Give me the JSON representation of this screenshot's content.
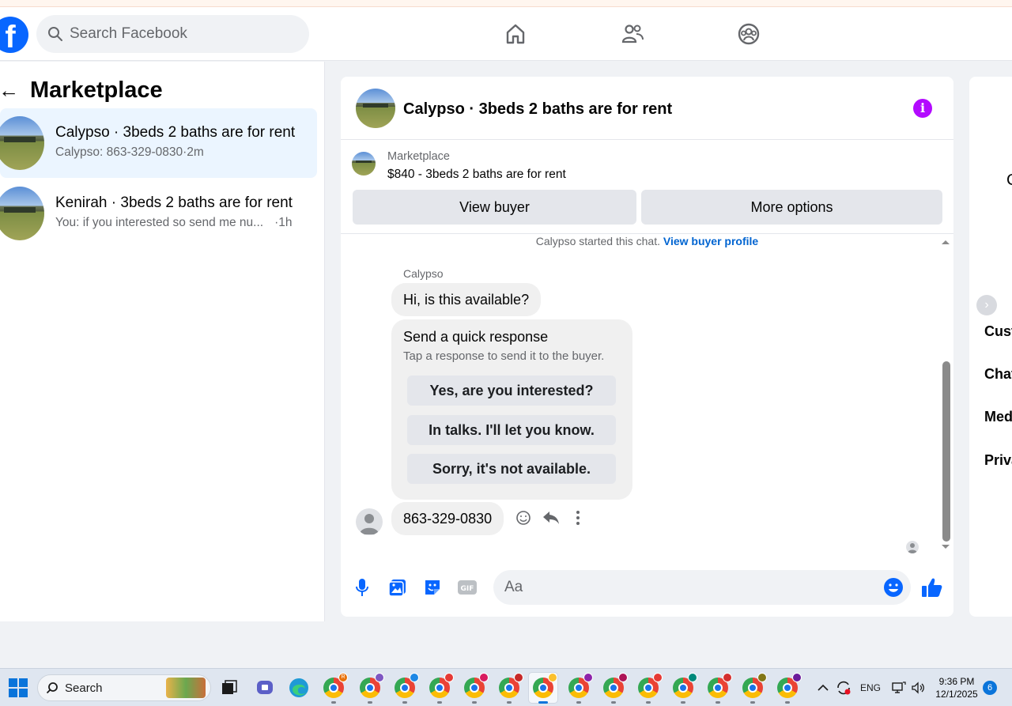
{
  "header": {
    "logo": "f",
    "search_placeholder": "Search Facebook",
    "nav": [
      "home-icon",
      "friends-icon",
      "groups-icon"
    ]
  },
  "left": {
    "title": "Marketplace",
    "conversations": [
      {
        "name": "Calypso · 3beds 2 baths are for rent",
        "preview": "Calypso: 863-329-0830·2m"
      },
      {
        "name": "Kenirah · 3beds 2 baths are for rent",
        "preview": "You: if you interested so send me nu...",
        "time": "·1h"
      }
    ]
  },
  "chat": {
    "title": "Calypso · 3beds 2 baths are for rent",
    "listing": {
      "category": "Marketplace",
      "price_title": "$840 - 3beds 2 baths are for rent",
      "view_buyer": "View buyer",
      "more_options": "More options"
    },
    "started_text": "Calypso started this chat.",
    "buyer_profile_link": "View buyer profile",
    "sender": "Calypso",
    "message1": "Hi, is this available?",
    "quick_response": {
      "title": "Send a quick response",
      "subtitle": "Tap a response to send it to the buyer.",
      "options": [
        "Yes, are you interested?",
        "In talks. I'll let you know.",
        "Sorry, it's not available."
      ]
    },
    "message2": "863-329-0830",
    "composer_placeholder": "Aa"
  },
  "right": {
    "letter": "C",
    "items": [
      "Cust",
      "Chat",
      "Med",
      "Priva"
    ]
  },
  "taskbar": {
    "search_label": "Search",
    "lang": "ENG",
    "time": "9:36 PM",
    "date": "12/1/2025",
    "notifications": "6",
    "profile_badge": "R"
  },
  "colors": {
    "brand": "#0866ff",
    "info": "#b30aff",
    "link": "#0064d1"
  }
}
